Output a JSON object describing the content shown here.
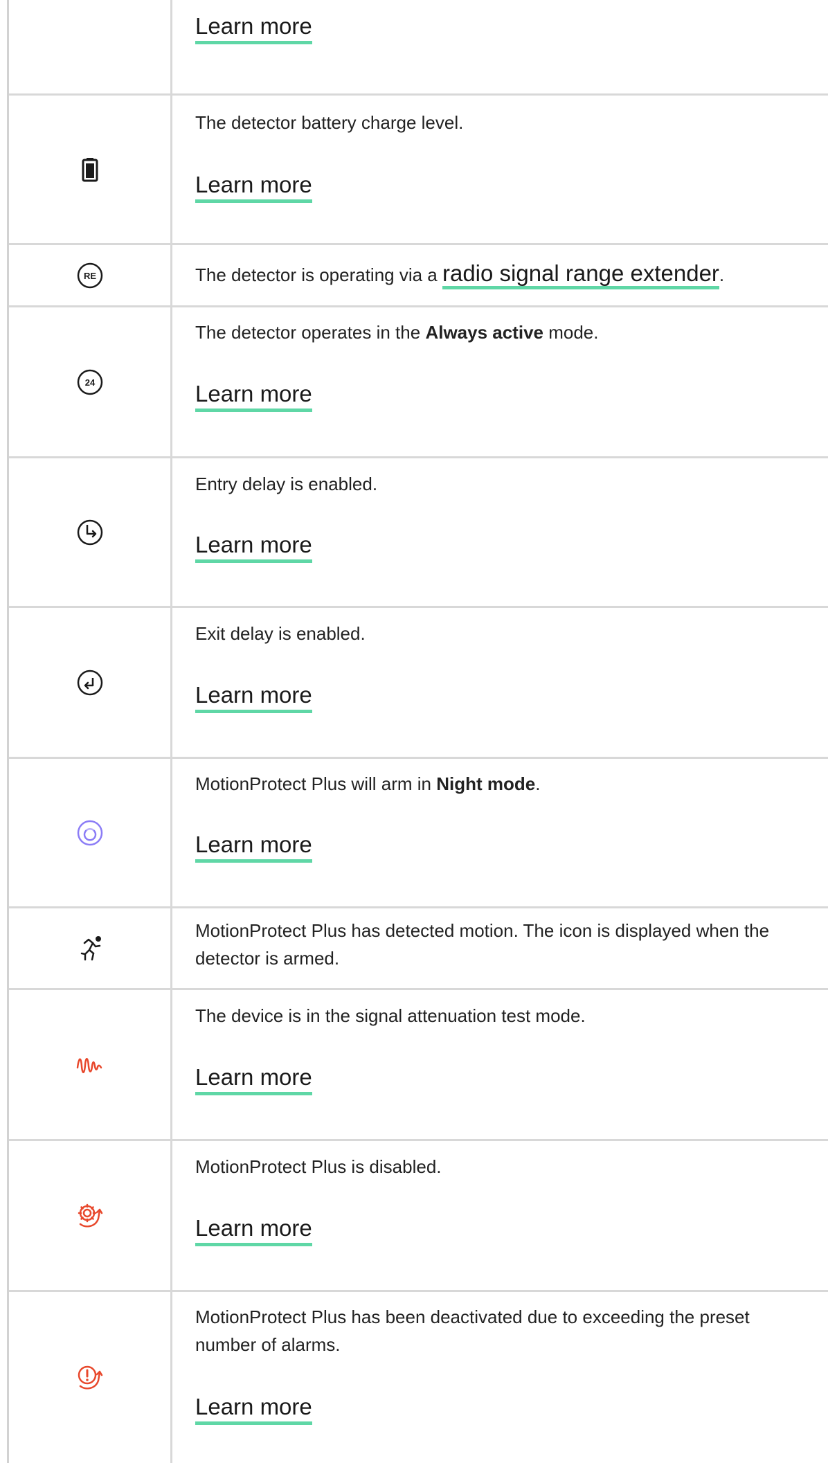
{
  "rows": [
    {
      "id": "top",
      "icon": "none",
      "desc": "",
      "learn": "Learn more"
    },
    {
      "id": "battery",
      "icon": "battery-icon",
      "desc": "The detector battery charge level.",
      "learn": "Learn more"
    },
    {
      "id": "re",
      "icon": "range-extender-icon",
      "desc_prefix": "The detector is operating via a ",
      "link": "radio signal range extender",
      "desc_suffix": "."
    },
    {
      "id": "always-active",
      "icon": "always-active-24-icon",
      "desc_prefix": "The detector operates in the ",
      "bold": "Always active",
      "desc_suffix": " mode.",
      "learn": "Learn more"
    },
    {
      "id": "entry-delay",
      "icon": "entry-delay-icon",
      "desc": "Entry delay is enabled.",
      "learn": "Learn more"
    },
    {
      "id": "exit-delay",
      "icon": "exit-delay-icon",
      "desc": "Exit delay is enabled.",
      "learn": "Learn more"
    },
    {
      "id": "night-mode",
      "icon": "night-mode-icon",
      "desc_prefix": "MotionProtect Plus will arm in ",
      "bold": "Night mode",
      "desc_suffix": ".",
      "learn": "Learn more"
    },
    {
      "id": "motion",
      "icon": "motion-detected-icon",
      "desc": "MotionProtect Plus has detected motion. The icon is displayed when the detector is armed."
    },
    {
      "id": "attenuation",
      "icon": "signal-attenuation-icon",
      "desc": "The device is in the signal attenuation test mode.",
      "learn": "Learn more"
    },
    {
      "id": "disabled",
      "icon": "disabled-icon",
      "desc": "MotionProtect Plus is disabled.",
      "learn": "Learn more"
    },
    {
      "id": "alarms",
      "icon": "alarm-limit-icon",
      "desc": "MotionProtect Plus has been deactivated due to exceeding the preset number of alarms.",
      "learn": "Learn more"
    }
  ],
  "colors": {
    "link_underline": "#5fd7a6",
    "night_mode_icon": "#8b7cf6",
    "alert_icon": "#e8482c",
    "border": "#d8d8d8"
  }
}
